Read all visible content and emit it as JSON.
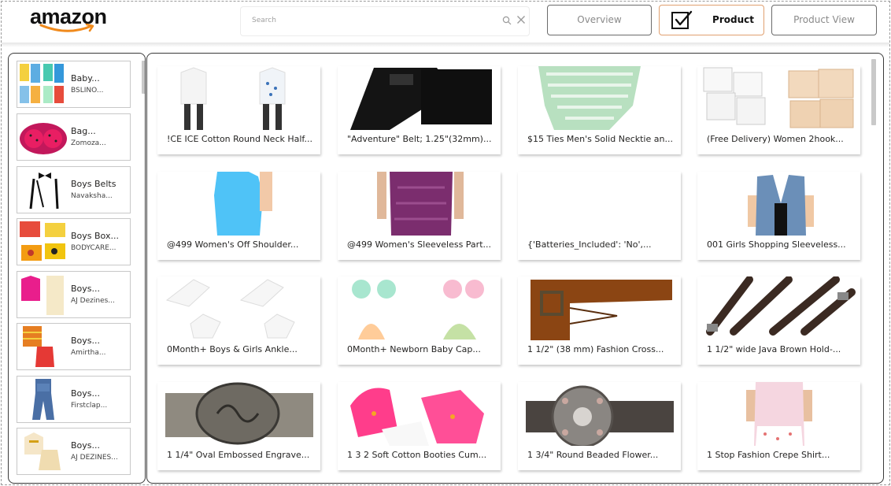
{
  "brand": {
    "logo_text": "amazon",
    "logo_color": "#111111",
    "smile_color": "#f08a1c"
  },
  "search": {
    "placeholder": "Search",
    "icon": "search-icon",
    "clear_icon": "close-icon"
  },
  "nav": {
    "overview_label": "Overview",
    "product_label": "Product",
    "product_view_label": "Product View",
    "active": "Product",
    "active_border_color": "#e0a070"
  },
  "sidebar": {
    "items": [
      {
        "title": "Baby...",
        "subtitle": "BSLINO..."
      },
      {
        "title": "Bag...",
        "subtitle": "Zomoza..."
      },
      {
        "title": "Boys Belts",
        "subtitle": "Navaksha..."
      },
      {
        "title": "Boys Box...",
        "subtitle": "BODYCARE..."
      },
      {
        "title": "Boys...",
        "subtitle": "AJ Dezines..."
      },
      {
        "title": "Boys...",
        "subtitle": "Amirtha..."
      },
      {
        "title": "Boys...",
        "subtitle": "Firstclap..."
      },
      {
        "title": "Boys...",
        "subtitle": "AJ DEZINES..."
      }
    ]
  },
  "products": {
    "items": [
      {
        "title": "!CE ICE Cotton Round Neck Half..."
      },
      {
        "title": "\"Adventure\" Belt; 1.25\"(32mm)..."
      },
      {
        "title": "$15 Ties Men's Solid Necktie an..."
      },
      {
        "title": "(Free Delivery) Women 2hook..."
      },
      {
        "title": "@499 Women's Off Shoulder..."
      },
      {
        "title": "@499 Women's Sleeveless Part..."
      },
      {
        "title": "{'Batteries_Included': 'No',..."
      },
      {
        "title": "001 Girls Shopping Sleeveless..."
      },
      {
        "title": "0Month+ Boys & Girls Ankle..."
      },
      {
        "title": "0Month+ Newborn Baby Cap..."
      },
      {
        "title": "1 1/2\" (38 mm) Fashion Cross..."
      },
      {
        "title": "1 1/2\" wide Java Brown Hold-..."
      },
      {
        "title": "1 1/4\" Oval Embossed Engrave..."
      },
      {
        "title": "1 3 2 Soft Cotton Booties Cum..."
      },
      {
        "title": "1 3/4\" Round Beaded Flower..."
      },
      {
        "title": "1 Stop Fashion Crepe Shirt..."
      }
    ]
  }
}
